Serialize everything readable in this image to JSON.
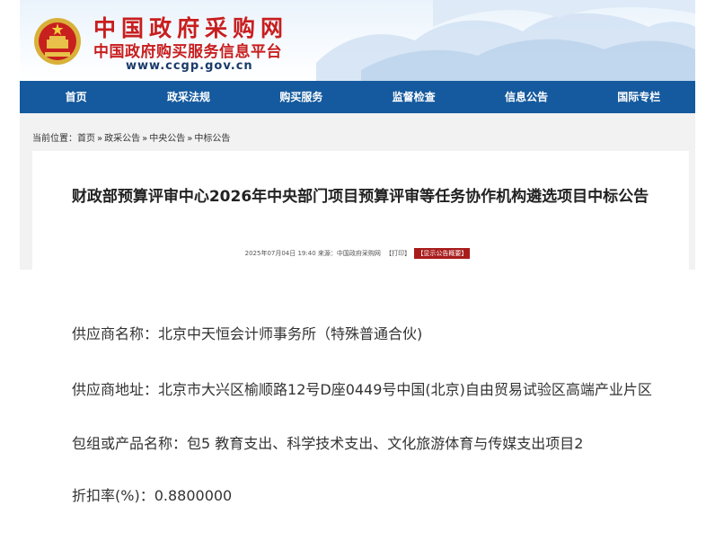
{
  "header": {
    "title": "中国政府采购网",
    "subtitle": "中国政府购买服务信息平台",
    "url": "www.ccgp.gov.cn"
  },
  "nav": [
    {
      "label": "首页"
    },
    {
      "label": "政采法规"
    },
    {
      "label": "购买服务"
    },
    {
      "label": "监督检查"
    },
    {
      "label": "信息公告"
    },
    {
      "label": "国际专栏"
    }
  ],
  "breadcrumb": {
    "prefix": "当前位置：",
    "items": [
      "首页",
      "政采公告",
      "中央公告",
      "中标公告"
    ],
    "separator": "»"
  },
  "article": {
    "title": "财政部预算评审中心2026年中央部门项目预算评审等任务协作机构遴选项目中标公告",
    "datetime": "2025年07月04日 19:40",
    "source": "来源：中国政府采购网",
    "print": "【打印】",
    "summary_button": "【显示公告概要】"
  },
  "fields": [
    {
      "label": "供应商名称：",
      "value": "北京中天恒会计师事务所（特殊普通合伙)"
    },
    {
      "label": "供应商地址：",
      "value": "北京市大兴区榆顺路12号D座0449号中国(北京)自由贸易试验区高端产业片区"
    },
    {
      "label": "包组或产品名称：",
      "value": "包5 教育支出、科学技术支出、文化旅游体育与传媒支出项目2"
    },
    {
      "label": "折扣率(%)：",
      "value": "0.8800000"
    }
  ],
  "colors": {
    "brand_red": "#c81e1e",
    "nav_blue": "#155a9e",
    "badge_red": "#a81c1c"
  }
}
